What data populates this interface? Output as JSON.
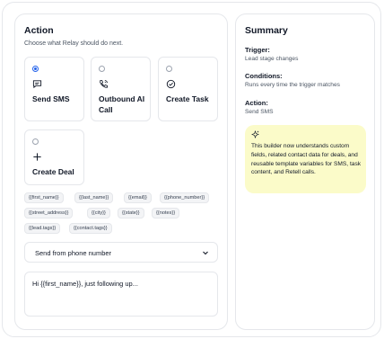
{
  "action": {
    "title": "Action",
    "subtitle": "Choose what Relay should do next.",
    "options": [
      {
        "label": "Send SMS",
        "icon": "message-icon",
        "selected": true
      },
      {
        "label": "Outbound AI Call",
        "icon": "phone-call-icon",
        "selected": false
      },
      {
        "label": "Create Task",
        "icon": "check-circle-icon",
        "selected": false
      },
      {
        "label": "Create Deal",
        "icon": "plus-icon",
        "selected": false
      }
    ],
    "variables": [
      "{{first_name}}",
      "{{last_name}}",
      "{{email}}",
      "{{phone_number}}",
      "{{street_address}}",
      "{{city}}",
      "{{state}}",
      "{{notes}}",
      "{{lead.tags}}",
      "{{contact.tags}}"
    ],
    "from_select": {
      "value": "Send from phone number",
      "icon": "chevron-down-icon"
    },
    "message": {
      "value": "Hi {{first_name}}, just following up..."
    }
  },
  "summary": {
    "title": "Summary",
    "trigger_label": "Trigger:",
    "trigger_value": "Lead  stage changes",
    "conditions_label": "Conditions:",
    "conditions_value": "Runs every time the trigger matches",
    "action_label": "Action:",
    "action_value": "Send SMS",
    "note": {
      "icon": "sparkle-icon",
      "text": "This builder now understands custom fields, related contact data for deals, and reusable template variables for SMS, task content, and Retell calls."
    }
  },
  "colors": {
    "accent": "#2563eb",
    "border": "#e5e7eb",
    "note_bg": "#fbfbc9",
    "tag_bg": "#f3f4f6"
  }
}
